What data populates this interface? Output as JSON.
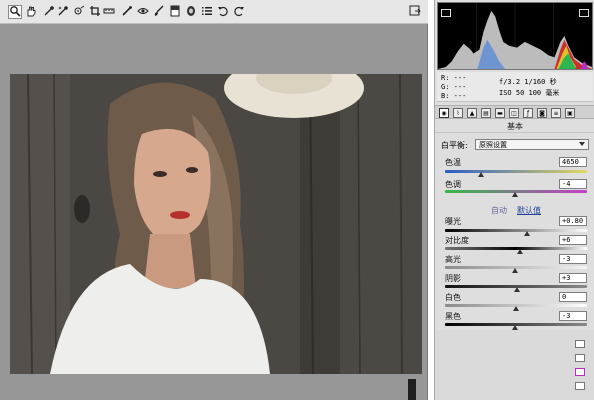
{
  "toolbar": {
    "tools": [
      {
        "name": "zoom-tool",
        "icon": "magnifier-icon"
      },
      {
        "name": "hand-tool",
        "icon": "hand-icon"
      },
      {
        "name": "white-balance-tool",
        "icon": "eyedropper-icon"
      },
      {
        "name": "color-sampler-tool",
        "icon": "color-sampler-icon"
      },
      {
        "name": "target-adjust-tool",
        "icon": "target-icon"
      },
      {
        "name": "crop-tool",
        "icon": "crop-icon"
      },
      {
        "name": "straighten-tool",
        "icon": "straighten-icon"
      },
      {
        "name": "spot-removal-tool",
        "icon": "spot-heal-icon"
      },
      {
        "name": "red-eye-tool",
        "icon": "eye-icon"
      },
      {
        "name": "adjustment-brush-tool",
        "icon": "brush-icon"
      },
      {
        "name": "graduated-filter-tool",
        "icon": "gradient-icon"
      },
      {
        "name": "radial-filter-tool",
        "icon": "radial-icon"
      },
      {
        "name": "preferences-tool",
        "icon": "preferences-icon"
      },
      {
        "name": "rotate-ccw-tool",
        "icon": "rotate-left-icon"
      },
      {
        "name": "rotate-cw-tool",
        "icon": "rotate-right-icon"
      }
    ],
    "fullscreen_icon": "fullscreen-icon"
  },
  "readout": {
    "r_label": "R:",
    "r_value": "---",
    "g_label": "G:",
    "g_value": "---",
    "b_label": "B:",
    "b_value": "---",
    "aperture_shutter": "f/3.2  1/160 秒",
    "iso_focal": "ISO 50  100 毫米"
  },
  "panel": {
    "tabs": [
      "basic-icon",
      "tone-curve-icon",
      "detail-icon",
      "hsl-icon",
      "split-toning-icon",
      "lens-icon",
      "fx-icon",
      "camera-calibration-icon",
      "presets-icon",
      "snapshots-icon"
    ],
    "section_title": "基本",
    "white_balance": {
      "label": "白平衡:",
      "value": "原照设置"
    },
    "auto_label": "自动",
    "default_label": "默认值",
    "sliders": [
      {
        "key": "temperature",
        "label": "色温",
        "value": "4650",
        "position": 0.25
      },
      {
        "key": "tint",
        "label": "色调",
        "value": "-4",
        "position": 0.49
      },
      {
        "key": "exposure",
        "label": "曝光",
        "value": "+0.80",
        "position": 0.58
      },
      {
        "key": "contrast",
        "label": "对比度",
        "value": "+6",
        "position": 0.53
      },
      {
        "key": "highlights",
        "label": "高光",
        "value": "-3",
        "position": 0.49
      },
      {
        "key": "shadows",
        "label": "阴影",
        "value": "+3",
        "position": 0.51
      },
      {
        "key": "whites",
        "label": "白色",
        "value": "0",
        "position": 0.5
      },
      {
        "key": "blacks",
        "label": "黑色",
        "value": "-3",
        "position": 0.49
      }
    ]
  },
  "colors": {
    "canvas_bg": "#979797",
    "panel_bg": "#dedede",
    "histogram_bg": "#000000"
  }
}
